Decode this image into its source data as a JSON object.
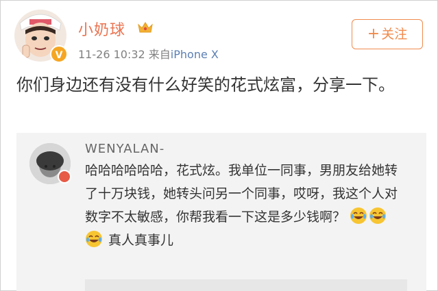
{
  "user": {
    "name": "小奶球",
    "timestamp": "11-26 10:32",
    "source_prefix": "来自",
    "source": "iPhone X",
    "follow_label": "关注",
    "follow_plus": "+"
  },
  "post": {
    "text": "你们身边还有没有什么好笑的花式炫富，分享一下。"
  },
  "quote": {
    "username": "WENYALAN-",
    "text": "哈哈哈哈哈哈，花式炫。我单位一同事，男朋友给她转了十万块钱，她转头问另一个同事，哎呀，我这个人对数字不太敏感，你帮我看一下这是多少钱啊？",
    "text_after_emoji": "真人真事儿"
  },
  "colors": {
    "accent_orange": "#eb7350",
    "follow_orange": "#f08a4c",
    "link_blue": "#5b7fb3",
    "verified_badge": "#f5a623",
    "quote_badge": "#e65a46"
  }
}
